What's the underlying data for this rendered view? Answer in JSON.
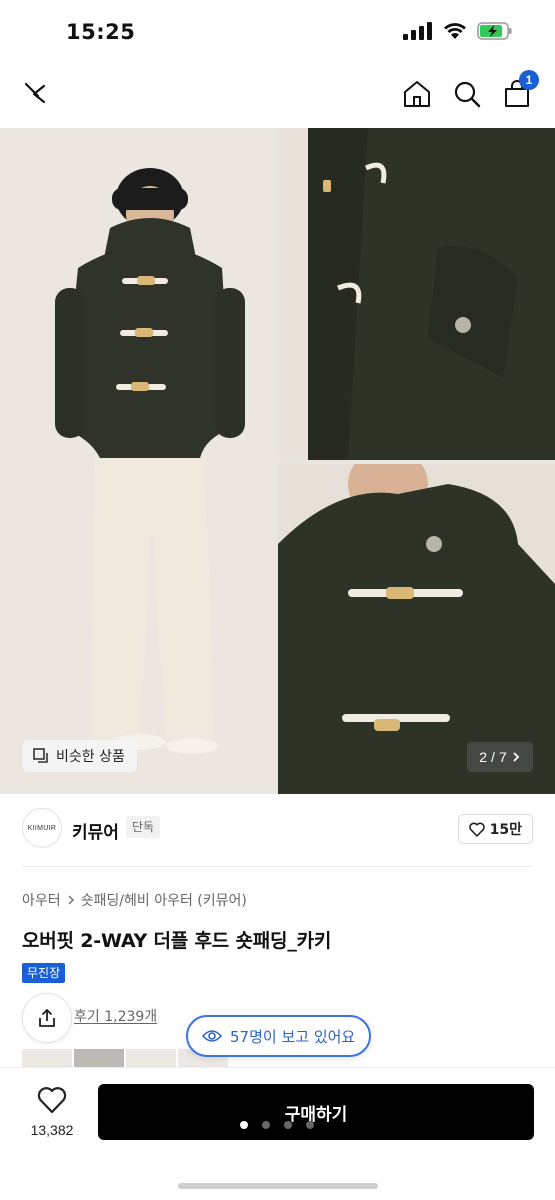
{
  "status_bar": {
    "time": "15:25"
  },
  "nav": {
    "cart_count": "1"
  },
  "gallery": {
    "similar_label": "비슷한 상품",
    "page_current": "2",
    "page_separator": "/",
    "page_total": "7"
  },
  "brand": {
    "logo_text": "KIIMUIR",
    "name": "키뮤어",
    "tag": "단독",
    "likes": "15만"
  },
  "breadcrumb": [
    "아우터",
    "숏패딩/헤비 아우터 (키뮤어)"
  ],
  "product": {
    "title": "오버핏 2-WAY 더플 후드 숏패딩_카키",
    "shipping_badge": "무진장",
    "review_link": "후기 1,239개",
    "viewers": "57명이 보고 있어요"
  },
  "bottom": {
    "wish_count": "13,382",
    "buy_label": "구매하기",
    "carousel_dots": 4,
    "active_dot": 0
  },
  "colors": {
    "accent": "#1a5fd6",
    "buy_button": "#000000",
    "jacket": "#2e3328"
  }
}
